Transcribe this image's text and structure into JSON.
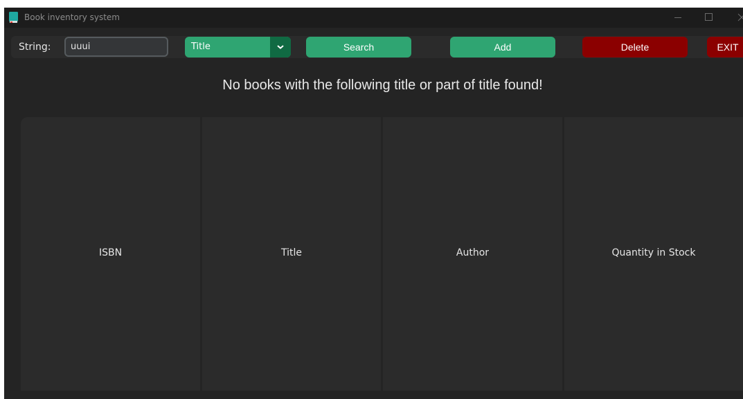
{
  "window": {
    "title": "Book inventory system",
    "icon": "book-icon"
  },
  "toolbar": {
    "string_label": "String:",
    "search_value": "uuui",
    "search_placeholder": "",
    "filter_selected": "Title",
    "search_label": "Search",
    "add_label": "Add",
    "delete_label": "Delete",
    "exit_label": "EXIT"
  },
  "message": "No books with the following title or part of title found!",
  "table": {
    "columns": [
      "ISBN",
      "Title",
      "Author",
      "Quantity in Stock"
    ],
    "rows": []
  },
  "colors": {
    "background": "#242424",
    "panel": "#2b2b2b",
    "accent_green": "#2fa572",
    "accent_green_dark": "#106a43",
    "danger_red": "#8b0000"
  }
}
